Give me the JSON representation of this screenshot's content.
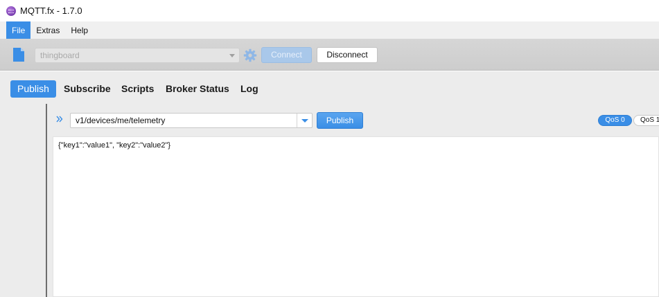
{
  "window": {
    "title": "MQTT.fx - 1.7.0",
    "app_icon": "mqttfx-logo-icon"
  },
  "menu": {
    "items": [
      {
        "label": "File",
        "active": true
      },
      {
        "label": "Extras",
        "active": false
      },
      {
        "label": "Help",
        "active": false
      }
    ]
  },
  "connection": {
    "profile_icon": "file-icon",
    "profile": "thingboard",
    "settings_icon": "gear-icon",
    "connect_label": "Connect",
    "disconnect_label": "Disconnect",
    "connected": true
  },
  "tabs": [
    {
      "label": "Publish",
      "active": true
    },
    {
      "label": "Subscribe",
      "active": false
    },
    {
      "label": "Scripts",
      "active": false
    },
    {
      "label": "Broker Status",
      "active": false
    },
    {
      "label": "Log",
      "active": false
    }
  ],
  "publish": {
    "topic": "v1/devices/me/telemetry",
    "publish_label": "Publish",
    "qos": [
      {
        "label": "QoS 0",
        "selected": true
      },
      {
        "label": "QoS 1",
        "selected": false
      }
    ],
    "payload": "{\"key1\":\"value1\", \"key2\":\"value2\"}"
  },
  "colors": {
    "accent": "#3a8ee6",
    "toolbar_bg": "#d0d0d0",
    "panel_bg": "#ececec"
  }
}
